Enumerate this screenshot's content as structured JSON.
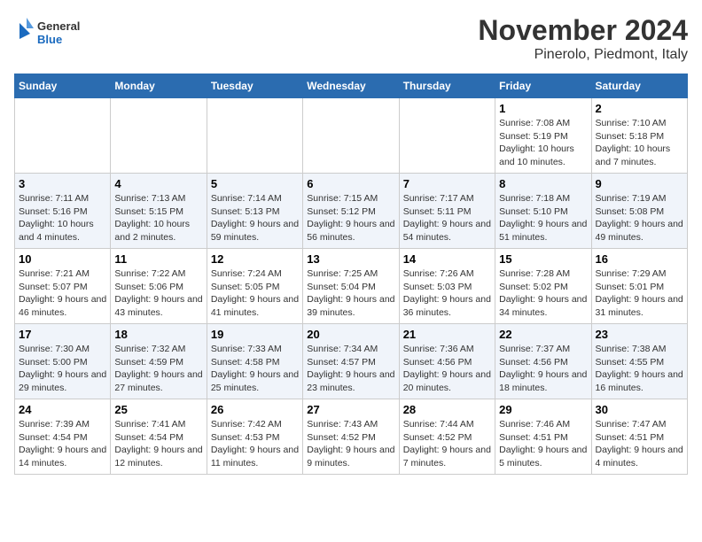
{
  "header": {
    "logo_general": "General",
    "logo_blue": "Blue",
    "month_year": "November 2024",
    "location": "Pinerolo, Piedmont, Italy"
  },
  "weekdays": [
    "Sunday",
    "Monday",
    "Tuesday",
    "Wednesday",
    "Thursday",
    "Friday",
    "Saturday"
  ],
  "weeks": [
    [
      {
        "day": "",
        "info": ""
      },
      {
        "day": "",
        "info": ""
      },
      {
        "day": "",
        "info": ""
      },
      {
        "day": "",
        "info": ""
      },
      {
        "day": "",
        "info": ""
      },
      {
        "day": "1",
        "info": "Sunrise: 7:08 AM\nSunset: 5:19 PM\nDaylight: 10 hours and 10 minutes."
      },
      {
        "day": "2",
        "info": "Sunrise: 7:10 AM\nSunset: 5:18 PM\nDaylight: 10 hours and 7 minutes."
      }
    ],
    [
      {
        "day": "3",
        "info": "Sunrise: 7:11 AM\nSunset: 5:16 PM\nDaylight: 10 hours and 4 minutes."
      },
      {
        "day": "4",
        "info": "Sunrise: 7:13 AM\nSunset: 5:15 PM\nDaylight: 10 hours and 2 minutes."
      },
      {
        "day": "5",
        "info": "Sunrise: 7:14 AM\nSunset: 5:13 PM\nDaylight: 9 hours and 59 minutes."
      },
      {
        "day": "6",
        "info": "Sunrise: 7:15 AM\nSunset: 5:12 PM\nDaylight: 9 hours and 56 minutes."
      },
      {
        "day": "7",
        "info": "Sunrise: 7:17 AM\nSunset: 5:11 PM\nDaylight: 9 hours and 54 minutes."
      },
      {
        "day": "8",
        "info": "Sunrise: 7:18 AM\nSunset: 5:10 PM\nDaylight: 9 hours and 51 minutes."
      },
      {
        "day": "9",
        "info": "Sunrise: 7:19 AM\nSunset: 5:08 PM\nDaylight: 9 hours and 49 minutes."
      }
    ],
    [
      {
        "day": "10",
        "info": "Sunrise: 7:21 AM\nSunset: 5:07 PM\nDaylight: 9 hours and 46 minutes."
      },
      {
        "day": "11",
        "info": "Sunrise: 7:22 AM\nSunset: 5:06 PM\nDaylight: 9 hours and 43 minutes."
      },
      {
        "day": "12",
        "info": "Sunrise: 7:24 AM\nSunset: 5:05 PM\nDaylight: 9 hours and 41 minutes."
      },
      {
        "day": "13",
        "info": "Sunrise: 7:25 AM\nSunset: 5:04 PM\nDaylight: 9 hours and 39 minutes."
      },
      {
        "day": "14",
        "info": "Sunrise: 7:26 AM\nSunset: 5:03 PM\nDaylight: 9 hours and 36 minutes."
      },
      {
        "day": "15",
        "info": "Sunrise: 7:28 AM\nSunset: 5:02 PM\nDaylight: 9 hours and 34 minutes."
      },
      {
        "day": "16",
        "info": "Sunrise: 7:29 AM\nSunset: 5:01 PM\nDaylight: 9 hours and 31 minutes."
      }
    ],
    [
      {
        "day": "17",
        "info": "Sunrise: 7:30 AM\nSunset: 5:00 PM\nDaylight: 9 hours and 29 minutes."
      },
      {
        "day": "18",
        "info": "Sunrise: 7:32 AM\nSunset: 4:59 PM\nDaylight: 9 hours and 27 minutes."
      },
      {
        "day": "19",
        "info": "Sunrise: 7:33 AM\nSunset: 4:58 PM\nDaylight: 9 hours and 25 minutes."
      },
      {
        "day": "20",
        "info": "Sunrise: 7:34 AM\nSunset: 4:57 PM\nDaylight: 9 hours and 23 minutes."
      },
      {
        "day": "21",
        "info": "Sunrise: 7:36 AM\nSunset: 4:56 PM\nDaylight: 9 hours and 20 minutes."
      },
      {
        "day": "22",
        "info": "Sunrise: 7:37 AM\nSunset: 4:56 PM\nDaylight: 9 hours and 18 minutes."
      },
      {
        "day": "23",
        "info": "Sunrise: 7:38 AM\nSunset: 4:55 PM\nDaylight: 9 hours and 16 minutes."
      }
    ],
    [
      {
        "day": "24",
        "info": "Sunrise: 7:39 AM\nSunset: 4:54 PM\nDaylight: 9 hours and 14 minutes."
      },
      {
        "day": "25",
        "info": "Sunrise: 7:41 AM\nSunset: 4:54 PM\nDaylight: 9 hours and 12 minutes."
      },
      {
        "day": "26",
        "info": "Sunrise: 7:42 AM\nSunset: 4:53 PM\nDaylight: 9 hours and 11 minutes."
      },
      {
        "day": "27",
        "info": "Sunrise: 7:43 AM\nSunset: 4:52 PM\nDaylight: 9 hours and 9 minutes."
      },
      {
        "day": "28",
        "info": "Sunrise: 7:44 AM\nSunset: 4:52 PM\nDaylight: 9 hours and 7 minutes."
      },
      {
        "day": "29",
        "info": "Sunrise: 7:46 AM\nSunset: 4:51 PM\nDaylight: 9 hours and 5 minutes."
      },
      {
        "day": "30",
        "info": "Sunrise: 7:47 AM\nSunset: 4:51 PM\nDaylight: 9 hours and 4 minutes."
      }
    ]
  ]
}
